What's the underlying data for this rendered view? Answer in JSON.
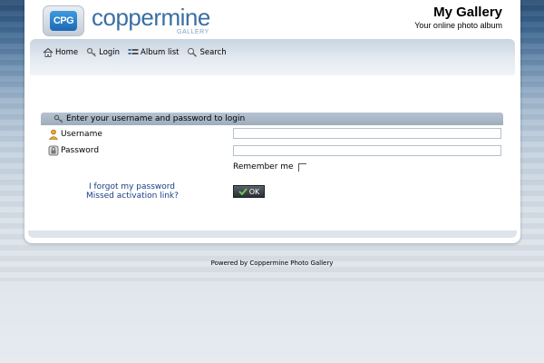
{
  "header": {
    "logo_text": "CPG",
    "brand_name": "coppermine",
    "brand_sub": "GALLERY",
    "site_title": "My Gallery",
    "site_description": "Your online photo album"
  },
  "nav": {
    "items": [
      {
        "label": "Home",
        "icon": "home-icon"
      },
      {
        "label": "Login",
        "icon": "key-icon"
      },
      {
        "label": "Album list",
        "icon": "album-list-icon"
      },
      {
        "label": "Search",
        "icon": "search-icon"
      }
    ]
  },
  "login": {
    "title": "Enter your username and password to login",
    "username_label": "Username",
    "username_value": "",
    "password_label": "Password",
    "password_value": "",
    "remember_label": "Remember me",
    "remember_checked": false,
    "forgot_link": "I forgot my password",
    "activation_link": "Missed activation link?",
    "submit_label": "OK"
  },
  "footer": {
    "text": "Powered by Coppermine Photo Gallery"
  },
  "colors": {
    "brand": "#3a6fa3",
    "link": "#1b3c84",
    "header_bar": "#a7b5c4",
    "button": "#3a3f45"
  }
}
